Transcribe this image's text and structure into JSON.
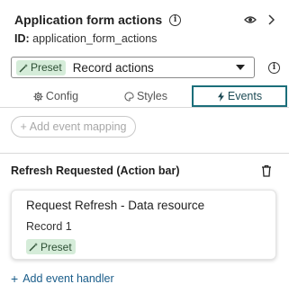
{
  "panel": {
    "title": "Application form actions",
    "id_label": "ID:",
    "id_value": "application_form_actions"
  },
  "preset_select": {
    "badge": "Preset",
    "value": "Record actions"
  },
  "tabs": [
    {
      "label": "Config",
      "icon": "gear-icon",
      "active": false
    },
    {
      "label": "Styles",
      "icon": "palette-icon",
      "active": false
    },
    {
      "label": "Events",
      "icon": "bolt-icon",
      "active": true
    }
  ],
  "add_event_mapping": "Add event mapping",
  "event_section": {
    "title": "Refresh Requested (Action bar)",
    "handler": {
      "title": "Request Refresh - Data resource",
      "subtitle": "Record 1",
      "badge": "Preset"
    }
  },
  "add_event_handler": "Add event handler",
  "colors": {
    "accent": "#1b6e7a",
    "badge_bg": "#d5ecd9",
    "link": "#1a5d8a"
  }
}
